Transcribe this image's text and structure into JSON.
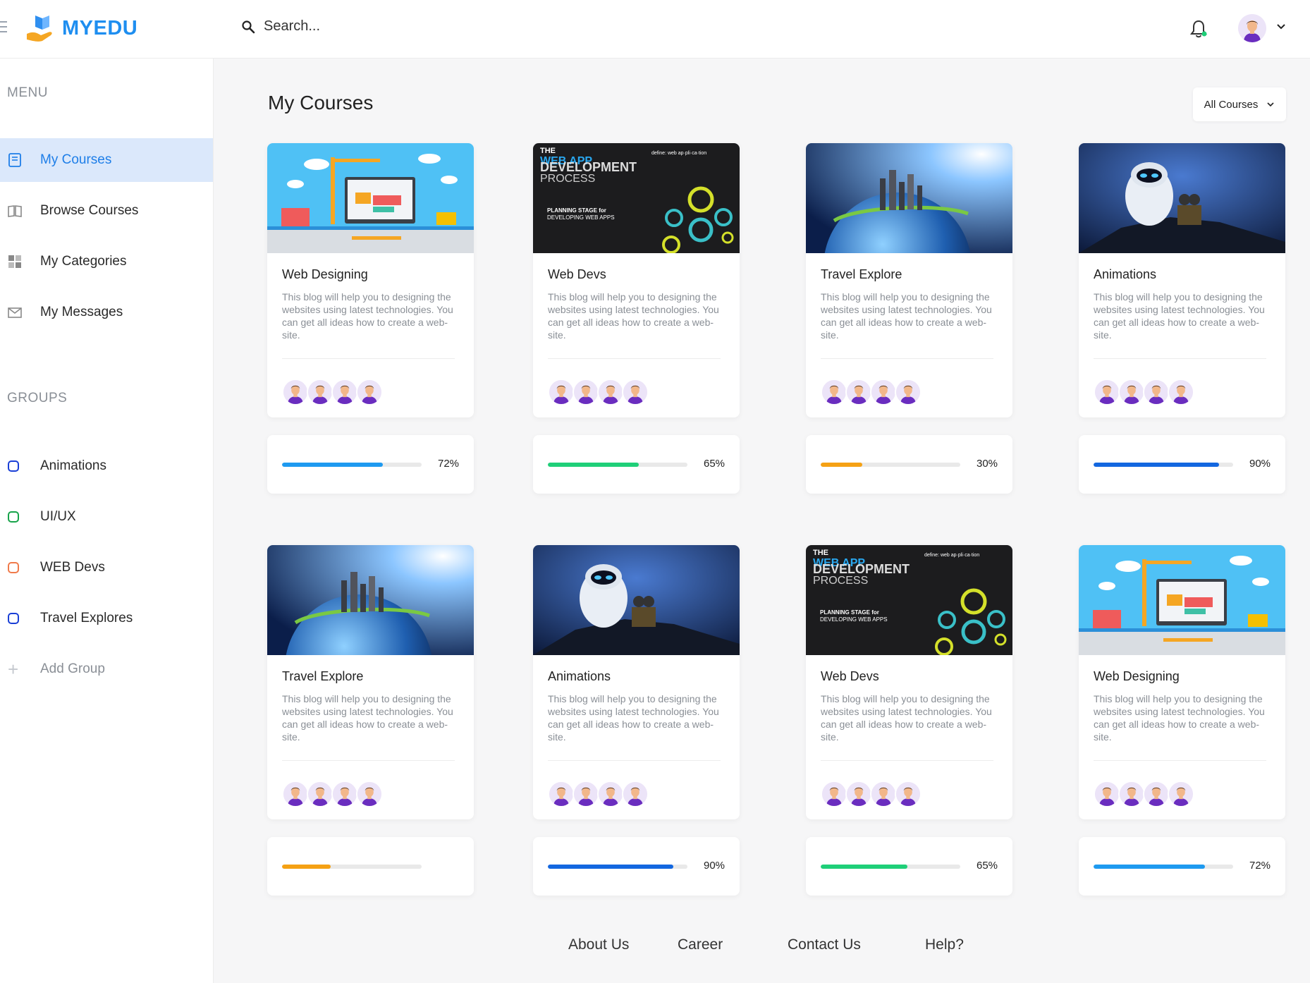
{
  "app": {
    "name": "MYEDU",
    "brand_color": "#1e8ef0"
  },
  "search": {
    "placeholder": "Search..."
  },
  "sidebar": {
    "menu_label": "MENU",
    "items": [
      {
        "label": "My Courses",
        "icon": "book-icon",
        "active": true
      },
      {
        "label": "Browse Courses",
        "icon": "open-book-icon",
        "active": false
      },
      {
        "label": "My Categories",
        "icon": "grid-icon",
        "active": false
      },
      {
        "label": "My Messages",
        "icon": "mail-icon",
        "active": false
      }
    ],
    "groups_label": "GROUPS",
    "groups": [
      {
        "label": "Animations",
        "color": "#1a3fd6"
      },
      {
        "label": "UI/UX",
        "color": "#17a34a"
      },
      {
        "label": "WEB Devs",
        "color": "#f07a4a"
      },
      {
        "label": "Travel Explores",
        "color": "#1a3fd6"
      }
    ],
    "add_group_label": "Add Group"
  },
  "main": {
    "title": "My Courses",
    "filter": {
      "selected": "All Courses"
    }
  },
  "courses": [
    {
      "title": "Web Designing",
      "image": "web-design",
      "description": "This blog will help you to designing the websites using latest technologies. You can get all ideas how to create a web-site.",
      "progress": 72,
      "progress_label": "72%",
      "bar_color": "#1e9af0"
    },
    {
      "title": "Web Devs",
      "image": "web-dev",
      "description": "This blog will help you to designing the websites using latest technologies. You can get all ideas how to create a web-site.",
      "progress": 65,
      "progress_label": "65%",
      "bar_color": "#1fcf78"
    },
    {
      "title": "Travel Explore",
      "image": "travel",
      "description": "This blog will help you to designing the websites using latest technologies. You can get all ideas how to create a web-site.",
      "progress": 30,
      "progress_label": "30%",
      "bar_color": "#f5a114"
    },
    {
      "title": "Animations",
      "image": "animation",
      "description": "This blog will help you to designing the websites using latest technologies. You can get all ideas how to create a web-site.",
      "progress": 90,
      "progress_label": "90%",
      "bar_color": "#1367e0"
    },
    {
      "title": "Travel Explore",
      "image": "travel",
      "description": "This blog will help you to designing the websites using latest technologies. You can get all ideas how to create a web-site.",
      "progress": 35,
      "progress_label": "",
      "bar_color": "#f5a114"
    },
    {
      "title": "Animations",
      "image": "animation",
      "description": "This blog will help you to designing the websites using latest technologies. You can get all ideas how to create a web-site.",
      "progress": 90,
      "progress_label": "90%",
      "bar_color": "#1367e0"
    },
    {
      "title": "Web Devs",
      "image": "web-dev",
      "description": "This blog will help you to designing the websites using latest technologies. You can get all ideas how to create a web-site.",
      "progress": 62,
      "progress_label": "65%",
      "bar_color": "#1fcf78"
    },
    {
      "title": "Web Designing",
      "image": "web-design",
      "description": "This blog will help you to designing the websites using latest technologies. You can get all ideas how to create a web-site.",
      "progress": 80,
      "progress_label": "72%",
      "bar_color": "#1e9af0"
    }
  ],
  "footer": {
    "links": [
      "About Us",
      "Career",
      "Contact Us",
      "Help?"
    ]
  },
  "thumb_text": {
    "web_dev_title1": "THE",
    "web_dev_title2": "WEB APP",
    "web_dev_title3": "DEVELOPMENT",
    "web_dev_title4": "PROCESS",
    "web_dev_define": "define: web ap·pli·ca·tion",
    "web_dev_planning": "PLANNING STAGE for",
    "web_dev_planning2": "DEVELOPING WEB APPS"
  }
}
